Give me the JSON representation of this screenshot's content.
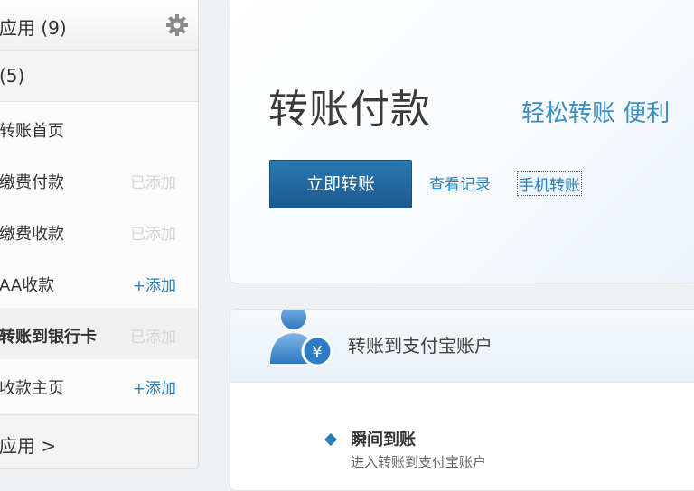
{
  "sidebar": {
    "header_title": "应用 (9)",
    "section_title": "(5)",
    "items": [
      {
        "label": "转账首页",
        "action": ""
      },
      {
        "label": "缴费付款",
        "action": "已添加"
      },
      {
        "label": "缴费收款",
        "action": "已添加"
      },
      {
        "label": "AA收款",
        "action": "+添加"
      },
      {
        "label": "转账到银行卡",
        "action": "已添加"
      },
      {
        "label": "收款主页",
        "action": "+添加"
      }
    ],
    "footer_title": "应用 >"
  },
  "main": {
    "title": "转账付款",
    "tagline": "轻松转账  便利",
    "primary_button": "立即转账",
    "link_records": "查看记录",
    "link_mobile": "手机转账"
  },
  "card2": {
    "title": "转账到支付宝账户",
    "feature_title": "瞬间到账",
    "feature_desc": "进入转账到支付宝账户"
  },
  "colors": {
    "accent": "#2a7fb6",
    "button": "#1f639b",
    "added": "#d4d4d4"
  },
  "icons": [
    "gear-icon",
    "person-yuan-icon",
    "diamond-bullet-icon"
  ]
}
